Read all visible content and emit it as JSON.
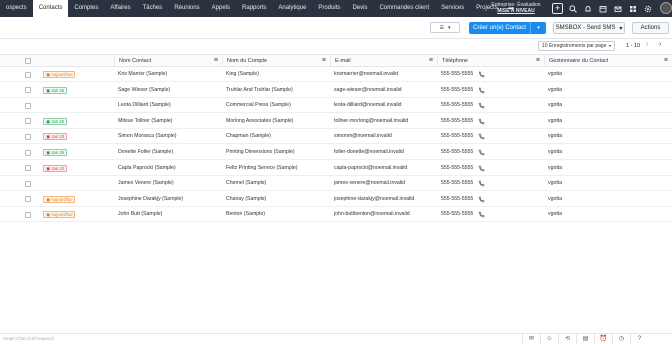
{
  "nav": {
    "items": [
      "ospects",
      "Contacts",
      "Comptes",
      "Affaires",
      "Tâches",
      "Réunions",
      "Appels",
      "Rapports",
      "Analytique",
      "Produits",
      "Devis",
      "Commandes client",
      "Services",
      "Projects"
    ],
    "active_index": 1,
    "more": "•••",
    "trial_title": "Entreprise- Évaluation",
    "trial_link": "MISE À NIVEAU",
    "icons": [
      "plus-icon",
      "search-icon",
      "bell-icon",
      "calendar-icon",
      "mail-icon",
      "grid-icon",
      "settings-icon"
    ]
  },
  "toolbar": {
    "view_icon": "☰",
    "view_caret": "▾",
    "create_label": "Créer un(e) Contact",
    "create_caret": "▾",
    "sms_label": "SMSBOX - Send SMS",
    "sms_caret": "▾",
    "actions_label": "Actions"
  },
  "pager": {
    "per_page": "10 Enregistrements par page",
    "per_page_caret": "▾",
    "range": "1 - 10",
    "prev": "‹",
    "next": "›"
  },
  "table": {
    "columns": [
      "Nom Contact",
      "Nom du Compte",
      "E-mail",
      "Téléphone",
      "Gestionnaire du Contact"
    ],
    "menu_glyph": "≡",
    "rows": [
      {
        "badge": "Aujourd'hui",
        "badge_color": "orange",
        "name": "Kris Marrier (Sample)",
        "account": "King (Sample)",
        "email": "krismarrier@noemail.invalid",
        "phone": "555-555-5555",
        "owner": "vgotta"
      },
      {
        "badge": "Jan 26",
        "badge_color": "green",
        "name": "Sage Wieser (Sample)",
        "account": "Truhlar And Truhlar (Sample)",
        "email": "sage-wieser@noemail.invalid",
        "phone": "555-555-5555",
        "owner": "vgotta"
      },
      {
        "badge": "",
        "badge_color": "",
        "name": "Leota Dilliard (Sample)",
        "account": "Commercial Press (Sample)",
        "email": "leota-dilliard@noemail.invalid",
        "phone": "555-555-5555",
        "owner": "vgotta"
      },
      {
        "badge": "Jan 26",
        "badge_color": "green",
        "name": "Mitsue Tollner (Sample)",
        "account": "Morlong Associates (Sample)",
        "email": "tollner-morlong@noemail.invalid",
        "phone": "555-555-5555",
        "owner": "vgotta"
      },
      {
        "badge": "Jan 23",
        "badge_color": "red",
        "name": "Simon Morasca (Sample)",
        "account": "Chapman (Sample)",
        "email": "simonm@noemail.invalid",
        "phone": "555-555-5555",
        "owner": "vgotta"
      },
      {
        "badge": "Jan 26",
        "badge_color": "green",
        "name": "Donette Foller (Sample)",
        "account": "Printing Dimensions (Sample)",
        "email": "foller-donette@noemail.invalid",
        "phone": "555-555-5555",
        "owner": "vgotta"
      },
      {
        "badge": "Jan 22",
        "badge_color": "red",
        "name": "Capla Paprocki (Sample)",
        "account": "Feltz Printing Service (Sample)",
        "email": "capla-paprocki@noemail.invalid",
        "phone": "555-555-5555",
        "owner": "vgotta"
      },
      {
        "badge": "",
        "badge_color": "",
        "name": "James Venere (Sample)",
        "account": "Chemel (Sample)",
        "email": "james-venere@noemail.invalid",
        "phone": "555-555-5555",
        "owner": "vgotta"
      },
      {
        "badge": "Aujourd'hui",
        "badge_color": "orange",
        "name": "Josephine Darakjy (Sample)",
        "account": "Chanay (Sample)",
        "email": "josephine-darakjy@noemail.invalid",
        "phone": "555-555-5555",
        "owner": "vgotta"
      },
      {
        "badge": "Aujourd'hui",
        "badge_color": "orange",
        "name": "John Butt (Sample)",
        "account": "Benton (Sample)",
        "email": "john-buttbenton@noemail.invalid",
        "phone": "555-555-5555",
        "owner": "vgotta"
      }
    ]
  },
  "footer": {
    "chat_placeholder": "Smart Chat (Ctrl+espace)",
    "icons": [
      "chat-icon",
      "contacts-icon",
      "history-icon",
      "note-icon",
      "alarm-icon",
      "clock-icon",
      "help-icon"
    ]
  },
  "colors": {
    "nav_bg": "#2c3340",
    "accent": "#1a8cf0"
  }
}
